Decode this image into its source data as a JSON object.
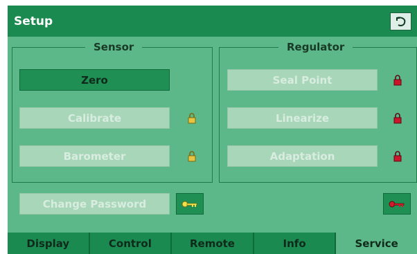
{
  "header": {
    "title": "Setup",
    "back_icon": "undo-arrow-icon"
  },
  "sensor": {
    "legend": "Sensor",
    "buttons": [
      {
        "label": "Zero",
        "state": "active"
      },
      {
        "label": "Calibrate",
        "state": "disabled",
        "locked": true
      },
      {
        "label": "Barometer",
        "state": "disabled",
        "locked": true
      }
    ]
  },
  "regulator": {
    "legend": "Regulator",
    "buttons": [
      {
        "label": "Seal Point",
        "state": "disabled",
        "locked": true
      },
      {
        "label": "Linearize",
        "state": "disabled",
        "locked": true
      },
      {
        "label": "Adaptation",
        "state": "disabled",
        "locked": true
      }
    ]
  },
  "password": {
    "change_label": "Change Password",
    "key_icon": "key-icon",
    "remove_key_icon": "key-icon"
  },
  "tabs": [
    "Display",
    "Control",
    "Remote",
    "Info",
    "Service"
  ],
  "selected_tab": "Service",
  "colors": {
    "background": "#5cb889",
    "header": "#1a8a50",
    "sensor_lock": "#e7c542",
    "regulator_lock": "#c9162a",
    "key_yellow": "#f2e14a",
    "key_red": "#d11a2a"
  }
}
